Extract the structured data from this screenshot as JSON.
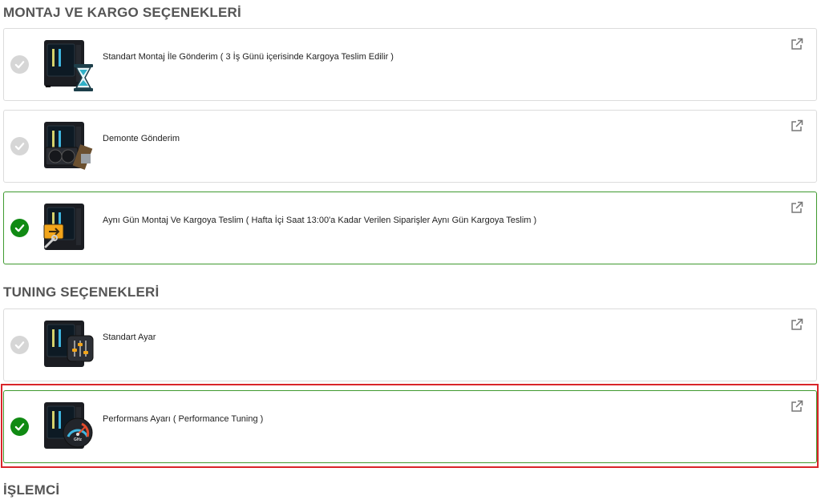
{
  "sections": {
    "assembly_title": "MONTAJ VE KARGO SEÇENEKLERİ",
    "tuning_title": "TUNING SEÇENEKLERİ",
    "cpu_title": "İŞLEMCİ"
  },
  "assembly_options": [
    {
      "label": "Standart Montaj İle Gönderim ( 3 İş Günü içerisinde Kargoya Teslim Edilir )",
      "selected": false,
      "badge": "hourglass-icon"
    },
    {
      "label": "Demonte Gönderim",
      "selected": false,
      "badge": "components-icon"
    },
    {
      "label": "Aynı Gün Montaj Ve Kargoya Teslim ( Hafta İçi Saat 13:00'a Kadar Verilen Siparişler Aynı Gün Kargoya Teslim )",
      "selected": true,
      "badge": "delivery-box-icon"
    }
  ],
  "tuning_options": [
    {
      "label": "Standart Ayar",
      "selected": false,
      "badge": "sliders-icon"
    },
    {
      "label": "Performans Ayarı ( Performance Tuning )",
      "selected": true,
      "badge": "speedometer-icon",
      "gauge_text": "GHz"
    }
  ],
  "colors": {
    "selected_border": "#3f9a2f",
    "selected_check": "#108a13",
    "unselected_check": "#d6d6d6",
    "highlight": "#d9252a"
  }
}
